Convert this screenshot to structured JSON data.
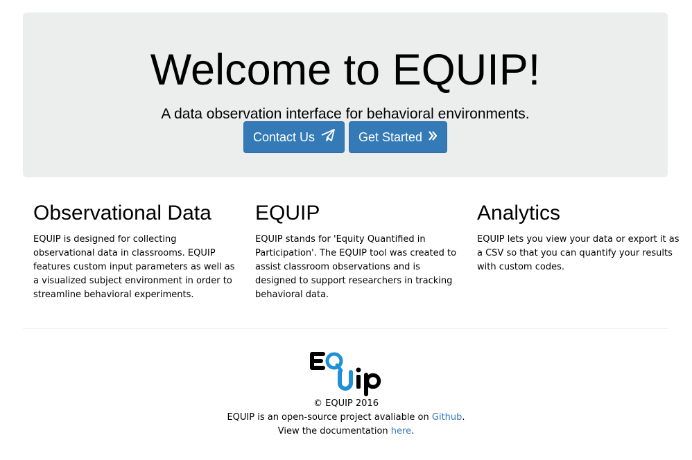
{
  "hero": {
    "title": "Welcome to EQUIP!",
    "subtitle": "A data observation interface for behavioral environments.",
    "contact_label": "Contact Us",
    "contact_icon": "paper-plane-icon",
    "start_label": "Get Started",
    "start_icon": "double-chevron-right-icon"
  },
  "features": [
    {
      "title": "Observational Data",
      "text": "EQUIP is designed for collecting observational data in classrooms. EQUIP features custom input parameters as well as a visualized subject environment in order to streamline behavioral experiments."
    },
    {
      "title": "EQUIP",
      "text": "EQUIP stands for 'Equity Quantified in Participation'. The EQUIP tool was created to assist classroom observations and is designed to support researchers in tracking behavioral data."
    },
    {
      "title": "Analytics",
      "text": "EQUIP lets you view your data or export it as a CSV so that you can quantify your results with custom codes."
    }
  ],
  "footer": {
    "logo_letters": "EQUIP",
    "copyright": "© EQUIP 2016",
    "line1_prefix": "EQUIP is an open-source project avaliable on ",
    "github_link": "Github",
    "line1_suffix": ".",
    "line2_prefix": "View the documentation ",
    "docs_link": "here",
    "line2_suffix": "."
  },
  "colors": {
    "jumbotron_bg": "#eceded",
    "primary": "#337ab7",
    "logo_dark": "#000000",
    "logo_accent": "#1e90d6"
  }
}
